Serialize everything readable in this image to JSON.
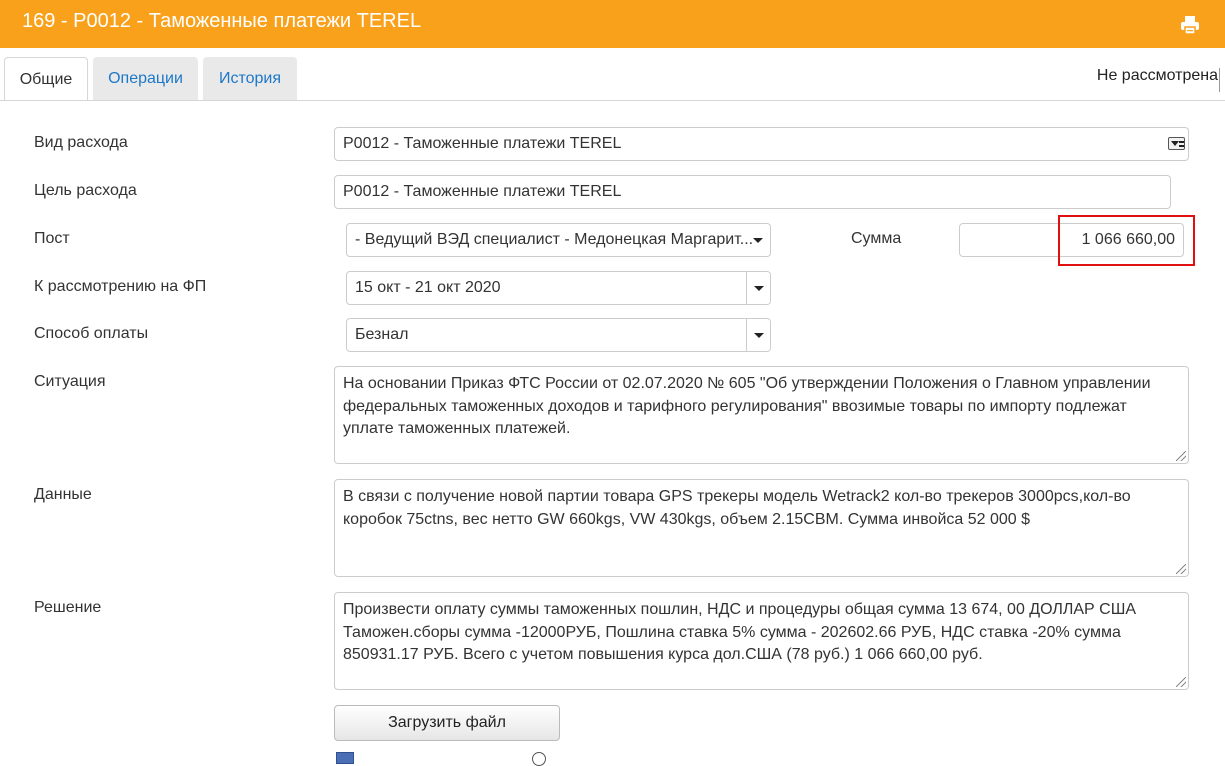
{
  "window": {
    "title": "169 - Р0012 - Таможенные платежи TEREL"
  },
  "tabs": [
    {
      "label": "Общие",
      "active": true
    },
    {
      "label": "Операции"
    },
    {
      "label": "История"
    }
  ],
  "status": "Не рассмотрена",
  "form": {
    "expense_type": {
      "label": "Вид расхода",
      "value": "Р0012 - Таможенные платежи TEREL"
    },
    "expense_goal": {
      "label": "Цель расхода",
      "value": "Р0012 - Таможенные платежи TEREL"
    },
    "post": {
      "label": "Пост",
      "value": "- Ведущий ВЭД специалист - Медонецкая Маргарит..."
    },
    "amount": {
      "label": "Сумма",
      "value": "1 066 660,00"
    },
    "review_fp": {
      "label": "К рассмотрению на ФП",
      "value": "15 окт - 21 окт 2020"
    },
    "payment_method": {
      "label": "Способ оплаты",
      "value": "Безнал"
    },
    "situation": {
      "label": "Ситуация",
      "value": "На основании Приказ ФТС России от 02.07.2020 № 605 \"Об утверждении Положения о Главном управлении федеральных таможенных доходов и тарифного регулирования\" ввозимые товары по импорту подлежат уплате таможенных платежей."
    },
    "data": {
      "label": "Данные",
      "value": "В связи с получение новой партии товара  GPS трекеры модель Wetrack2 кол-во трекеров 3000pcs,кол-во коробок 75ctns, вес нетто GW 660kgs, VW 430kgs, объем  2.15CBM. Сумма инвойса 52 000 $"
    },
    "decision": {
      "label": "Решение",
      "value": "Произвести оплату суммы таможенных пошлин, НДС и процедуры общая сумма 13 674, 00 ДОЛЛАР США Таможен.сборы сумма -12000РУБ, Пошлина ставка  5% сумма - 202602.66 РУБ, НДС ставка -20% сумма 850931.17 РУБ. Всего с учетом повышения курса дол.США  (78 руб.)  1 066 660,00 руб."
    }
  },
  "upload_button": "Загрузить файл",
  "attachment": {
    "icon": "file-icon"
  },
  "colors": {
    "header_bg": "#f9a11b",
    "tab_link": "#1e78c8",
    "highlight": "#e01010"
  }
}
